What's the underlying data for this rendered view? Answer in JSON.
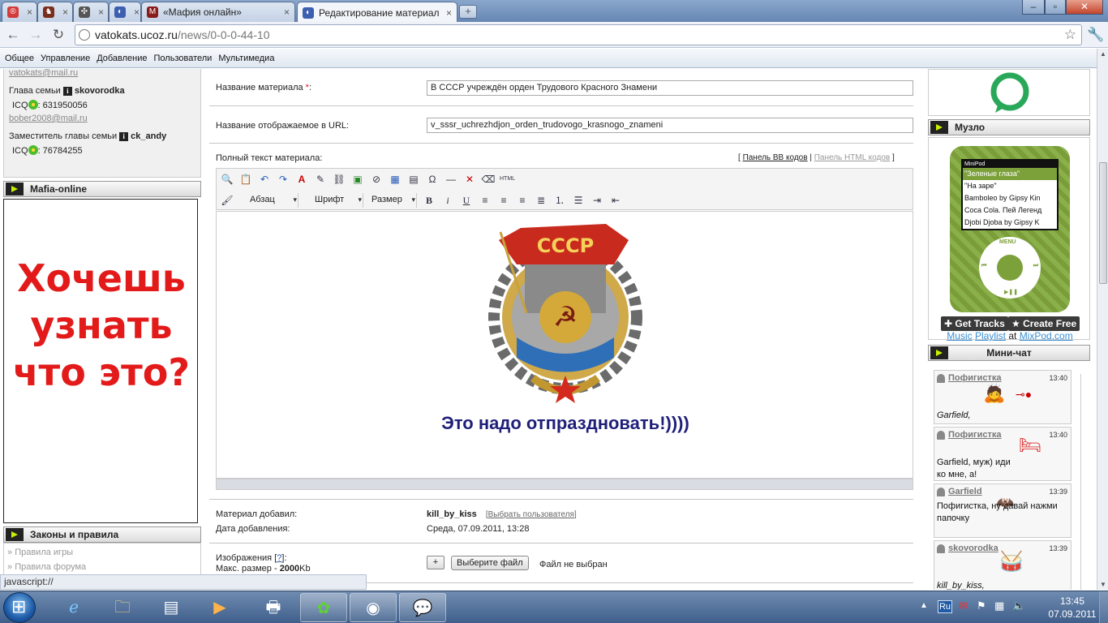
{
  "browser": {
    "tabs": [
      {
        "label": "",
        "color": "#d23b3b"
      },
      {
        "label": "",
        "color": "#7a2e1d"
      },
      {
        "label": "",
        "color": "#555555"
      },
      {
        "label": "",
        "color": "#3c5fb0"
      },
      {
        "label": "«Мафия онлайн»",
        "color": "#8b1b1b"
      },
      {
        "label": "Редактирование материал",
        "color": "#3c5fb0"
      }
    ],
    "url_host": "vatokats.ucoz.ru",
    "url_path": "/news/0-0-0-44-10"
  },
  "adminbar": {
    "items": [
      "Общее",
      "Управление",
      "Добавление",
      "Пользователи",
      "Мультимедиа"
    ]
  },
  "left": {
    "email_top": "vatokats@mail.ru",
    "head_label": "Глава семьи",
    "head_name": "skovorodka",
    "icq_label": "ICQ",
    "head_icq": ": 631950056",
    "head_email": "bober2008@mail.ru",
    "deputy_label": "Заместитель главы семьи",
    "deputy_name": "ck_andy",
    "deputy_icq": ": 76784255",
    "mafia_header": "Mafia-online",
    "mafia_text": "Хочешь узнать что это?",
    "rules_header": "Законы и правила",
    "rules_links": [
      "Правила игры",
      "Правила форума"
    ]
  },
  "form": {
    "title_label": "Название материала",
    "required_mark": "*",
    "title_value": "В СССР учреждён орден Трудового Красного Знамени",
    "url_label": "Название отображаемое в URL:",
    "url_value": "v_sssr_uchrezhdjon_orden_trudovogo_krasnogo_znameni",
    "fulltext_label": "Полный текст материала:",
    "bb_panel": "Панель BB кодов",
    "html_panel": "Панель HTML кодов",
    "format_select": "Абзац",
    "font_select": "Шрифт",
    "size_select": "Размер",
    "badge_text": "СССР",
    "celebrate_text": "Это надо отпраздновать!))))",
    "added_by_label": "Материал добавил:",
    "added_by_value": "kill_by_kiss",
    "choose_user": "Выбрать пользователя",
    "date_label": "Дата добавления:",
    "date_value": "Среда, 07.09.2011, 13:28",
    "images_label": "Изображения",
    "help_mark": "?",
    "max_size_label": "Макс. размер -",
    "max_size_value": "2000",
    "max_size_unit": "Kb",
    "plus_button": "+",
    "choose_file": "Выберите файл",
    "no_file": "Файл не выбран"
  },
  "right": {
    "muzlo_header": "Музло",
    "player_brand": "MiniPod",
    "songs": [
      "\"Зеленые глаза\"",
      "\"На заре\"",
      "Bamboleo by Gipsy Kin",
      "Coca Cola. Пей Легенд",
      "Djobi Djoba by Gipsy K"
    ],
    "menu_label": "MENU",
    "get_tracks": "Get Tracks",
    "create_free": "Create Free",
    "link_music": "Music",
    "link_playlist": "Playlist",
    "link_at": "at",
    "link_mixpod": "MixPod.com",
    "chat_header": "Мини-чат",
    "messages": [
      {
        "user": "Пофигистка",
        "time": "13:40",
        "text": "Garfield,"
      },
      {
        "user": "Пофигистка",
        "time": "13:40",
        "text": "Garfield, муж) иди ко мне, а!"
      },
      {
        "user": "Garfield",
        "time": "13:39",
        "text": "Пофигистка, ну давай нажми папочку"
      },
      {
        "user": "skovorodka",
        "time": "13:39",
        "text": "kill_by_kiss,"
      }
    ]
  },
  "statusbar": {
    "text": "javascript://"
  },
  "taskbar": {
    "lang": "Ru",
    "time": "13:45",
    "date": "07.09.2011"
  },
  "colors": {
    "accent_red": "#e31a1a",
    "celebrate_blue": "#1f1f7a",
    "mixpod_green": "#7da13a",
    "link_blue": "#3a8fd5"
  }
}
